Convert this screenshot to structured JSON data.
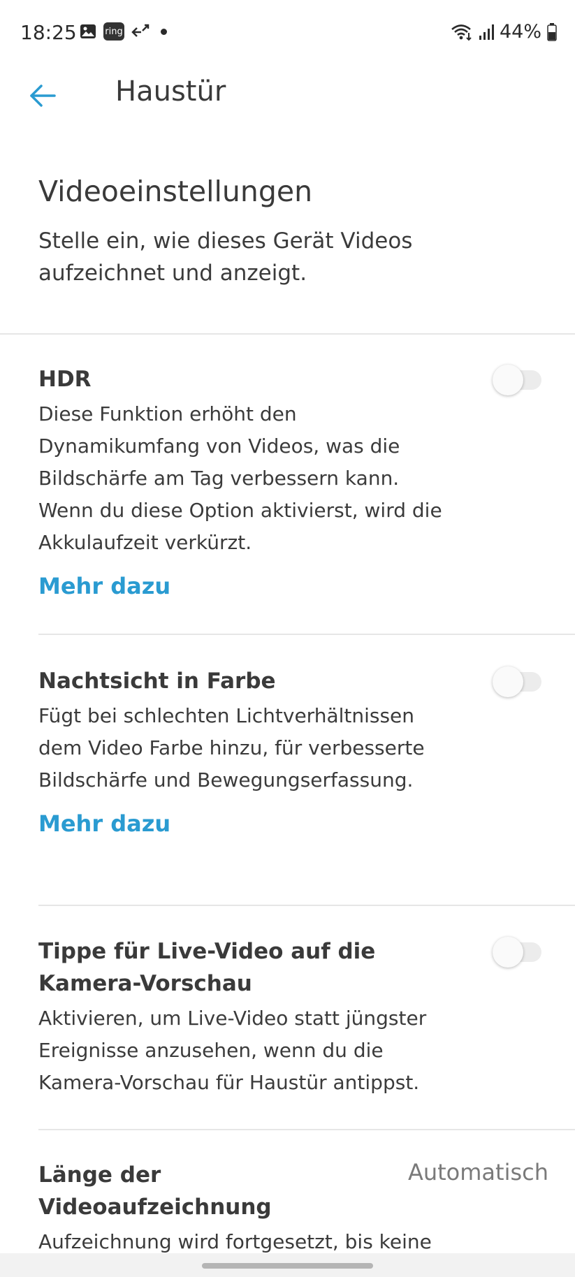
{
  "status_bar": {
    "time": "18:25",
    "ring_badge": "ring",
    "battery": "44%"
  },
  "app_bar": {
    "title": "Haustür"
  },
  "header": {
    "title": "Videoeinstellungen",
    "subtitle": "Stelle ein, wie dieses Gerät Videos aufzeichnet und anzeigt."
  },
  "settings": [
    {
      "title": "HDR",
      "description": "Diese Funktion erhöht den Dynamikumfang von Videos, was die Bildschärfe am Tag verbessern kann. Wenn du diese Option aktivierst, wird die Akkulaufzeit verkürzt.",
      "link": "Mehr dazu",
      "enabled": false
    },
    {
      "title": "Nachtsicht in Farbe",
      "description": "Fügt bei schlechten Lichtverhältnissen dem Video Farbe hinzu, für verbesserte Bildschärfe und Bewegungserfassung.",
      "link": "Mehr dazu",
      "enabled": false
    },
    {
      "title": "Tippe für Live-Video auf die Kamera-Vorschau",
      "description": "Aktivieren, um Live-Video statt jüngster Ereignisse anzusehen, wenn du die Kamera-Vorschau für Haustür antippst.",
      "enabled": false
    },
    {
      "title": "Länge der Videoaufzeichnung",
      "value": "Automatisch",
      "description": "Aufzeichnung wird fortgesetzt, bis keine"
    }
  ],
  "colors": {
    "accent": "#2a9bd1",
    "text": "#3b3b3b",
    "divider": "#e6e6e6"
  }
}
